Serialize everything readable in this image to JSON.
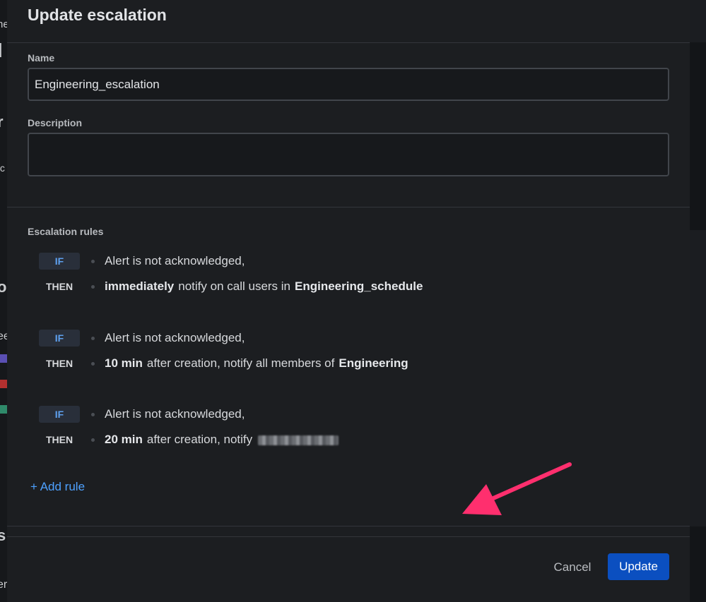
{
  "background": {
    "fragments": [
      "ne",
      "l",
      "r",
      "tc",
      "o",
      "ee",
      "s",
      "er"
    ],
    "bar_colors": [
      "#5a4fb3",
      "#b3302f",
      "#2f8a6a"
    ]
  },
  "modal": {
    "title": "Update escalation",
    "name_label": "Name",
    "name_value": "Engineering_escalation",
    "description_label": "Description",
    "description_value": "",
    "rules_label": "Escalation rules",
    "rules": [
      {
        "if_label": "IF",
        "then_label": "THEN",
        "condition": "Alert is not acknowledged,",
        "timing": "immediately",
        "action": "notify on call users in",
        "target": "Engineering_schedule"
      },
      {
        "if_label": "IF",
        "then_label": "THEN",
        "condition": "Alert is not acknowledged,",
        "timing": "10 min",
        "action": "after creation, notify all members of",
        "target": "Engineering"
      },
      {
        "if_label": "IF",
        "then_label": "THEN",
        "condition": "Alert is not acknowledged,",
        "timing": "20 min",
        "action": "after creation, notify",
        "target": ""
      }
    ],
    "add_rule_label": "+ Add rule",
    "cancel_label": "Cancel",
    "update_label": "Update"
  },
  "colors": {
    "accent": "#0b4fc0",
    "link": "#4ea1ff",
    "annotation_arrow": "#ff2f6e"
  }
}
